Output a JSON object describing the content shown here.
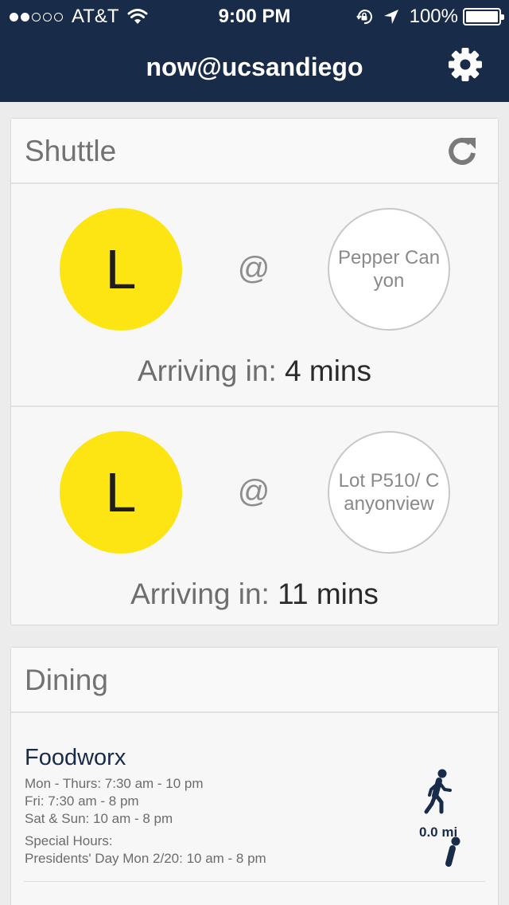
{
  "status_bar": {
    "carrier": "AT&T",
    "time": "9:00 PM",
    "battery": "100%",
    "icons": [
      "signal-dots-icon",
      "wifi-icon",
      "rotation-lock-icon",
      "location-arrow-icon",
      "battery-icon"
    ]
  },
  "header": {
    "title": "now@ucsandiego",
    "settings_icon": "gear-icon"
  },
  "shuttle": {
    "title": "Shuttle",
    "refresh_icon": "refresh-icon",
    "arrivals": [
      {
        "route": "L",
        "at": "@",
        "stop": "Pepper Canyon",
        "arriving_label": "Arriving in:",
        "eta": "4 mins"
      },
      {
        "route": "L",
        "at": "@",
        "stop": "Lot P510/ Canyonview",
        "arriving_label": "Arriving in:",
        "eta": "11 mins"
      }
    ],
    "colors": {
      "route_circle": "#fde513"
    }
  },
  "dining": {
    "title": "Dining",
    "items": [
      {
        "name": "Foodworx",
        "hours": [
          "Mon - Thurs: 7:30 am - 10 pm",
          "Fri: 7:30 am - 8 pm",
          "Sat & Sun: 10 am - 8 pm"
        ],
        "special_label": "Special Hours:",
        "special_hours": "Presidents' Day Mon 2/20: 10 am - 8 pm",
        "distance": "0.0 mi",
        "icon": "walking-person-icon"
      }
    ]
  },
  "colors": {
    "header_bg": "#182b49",
    "accent": "#182b49",
    "background": "#ececec"
  }
}
